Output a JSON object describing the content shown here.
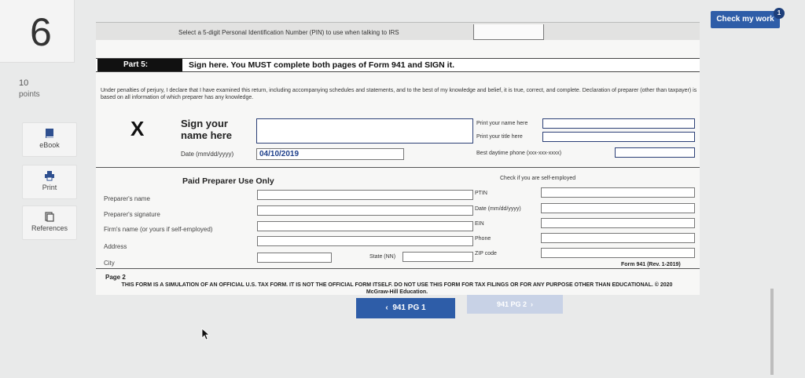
{
  "question": {
    "number": "6",
    "points_value": "10",
    "points_label": "points"
  },
  "sidebar": [
    {
      "label": "eBook",
      "icon": "book-icon"
    },
    {
      "label": "Print",
      "icon": "printer-icon"
    },
    {
      "label": "References",
      "icon": "references-icon"
    }
  ],
  "header": {
    "check_label": "Check my work",
    "badge": "1"
  },
  "form": {
    "pin_text": "Select a 5-digit Personal Identification Number (PIN) to use when talking to IRS",
    "part_tag": "Part 5:",
    "part_title": "Sign here.  You MUST complete both pages of Form 941 and SIGN it.",
    "perjury": "Under penalties of perjury, I declare that I have examined this return, including accompanying schedules and statements, and to the best of my knowledge and belief, it is true, correct, and complete. Declaration of preparer (other than taxpayer) is based on all information of which preparer has any knowledge.",
    "sign_x": "X",
    "sign_label": "Sign your name here",
    "print_name_label": "Print your name here",
    "print_title_label": "Print your title here",
    "date_label": "Date (mm/dd/yyyy)",
    "date_value": "04/10/2019",
    "phone_label": "Best daytime phone (xxx-xxx-xxxx)",
    "paid_title": "Paid Preparer Use Only",
    "self_employed_label": "Check if you are self-employed",
    "preparer_name": "Preparer's name",
    "preparer_signature": "Preparer's signature",
    "firm_name": "Firm's name (or yours if self-employed)",
    "address": "Address",
    "city": "City",
    "state_label": "State (NN)",
    "ptin": "PTIN",
    "prep_date": "Date (mm/dd/yyyy)",
    "ein": "EIN",
    "phone": "Phone",
    "zip": "ZIP code",
    "form_footer": "Form 941 (Rev. 1-2019)",
    "page_label": "Page 2",
    "disclaimer": "THIS FORM IS A SIMULATION OF AN OFFICIAL U.S. TAX FORM. IT IS NOT THE OFFICIAL FORM ITSELF. DO NOT USE THIS FORM FOR TAX FILINGS OR FOR ANY PURPOSE OTHER THAN EDUCATIONAL. © 2020 McGraw-Hill Education."
  },
  "nav": {
    "prev_label": "941 PG 1",
    "next_label": "941 PG 2"
  },
  "colors": {
    "accent": "#2e5da8",
    "disabled": "#c8d2e6"
  }
}
